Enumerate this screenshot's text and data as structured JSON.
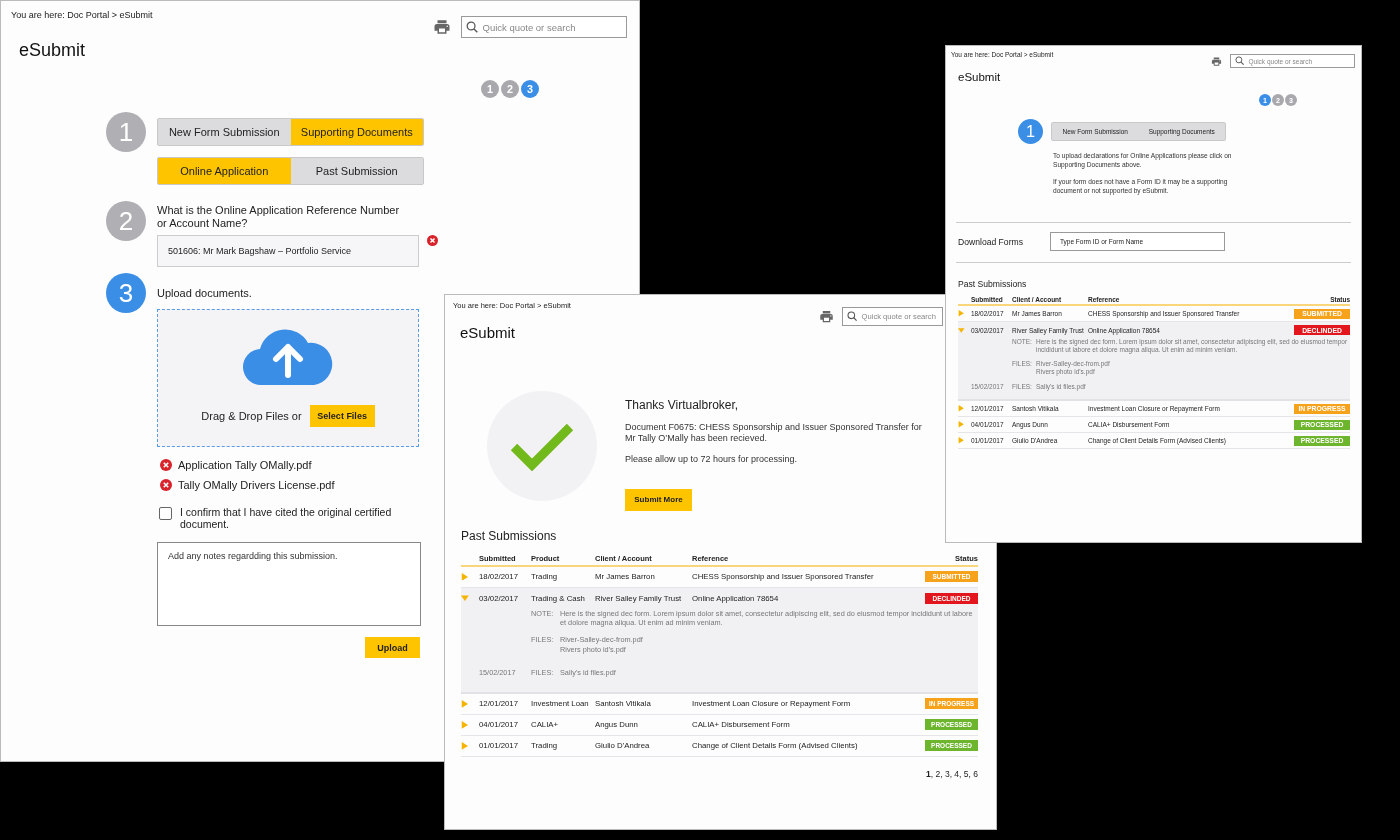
{
  "upload_screen": {
    "breadcrumb": "You are here: Doc Portal > eSubmit",
    "search": {
      "placeholder": "Quick quote or search"
    },
    "title": "eSubmit",
    "progress": [
      {
        "label": "1",
        "selected": false
      },
      {
        "label": "2",
        "selected": false
      },
      {
        "label": "3",
        "selected": true
      }
    ],
    "step_1": {
      "number": "1",
      "selected": false,
      "toggle_groups": [
        {
          "options": [
            {
              "label": "New Form Submission",
              "selected": false
            },
            {
              "label": "Supporting Documents",
              "selected": true
            }
          ]
        },
        {
          "options": [
            {
              "label": "Online Application",
              "selected": true
            },
            {
              "label": "Past Submission",
              "selected": false
            }
          ]
        }
      ]
    },
    "step_2": {
      "number": "2",
      "selected": false,
      "question": "What is the Online Application Reference Number or Account Name?",
      "answer": {
        "value": "501606: Mr Mark Bagshaw – Portfolio Service"
      }
    },
    "step_3": {
      "number": "3",
      "selected": true,
      "label": "Upload documents.",
      "dropzone": {
        "text": "Drag & Drop Files or",
        "button": "Select Files"
      },
      "files": [
        "Application Tally OMally.pdf",
        "Tally OMally Drivers License.pdf"
      ],
      "confirm": {
        "label": "I confirm that I have cited the original certified document.",
        "checked": false
      },
      "notes": {
        "placeholder": "Add any notes regardding this submission."
      },
      "submit": "Upload"
    }
  },
  "intro_screen": {
    "breadcrumb": "You are here: Doc Portal > eSubmit",
    "search": {
      "placeholder": "Quick quote or search"
    },
    "title": "eSubmit",
    "progress": [
      {
        "label": "1",
        "selected": true
      },
      {
        "label": "2",
        "selected": false
      },
      {
        "label": "3",
        "selected": false
      }
    ],
    "step_1": {
      "number": "1",
      "selected": true,
      "options": [
        {
          "label": "New Form Submission",
          "selected": false
        },
        {
          "label": "Supporting Documents",
          "selected": false
        }
      ]
    },
    "info": [
      "To upload declarations for Online Applications please click on Supporting Documents above.",
      "If your form does not have a Form ID it may be a supporting document or not supported by eSubmit."
    ],
    "download_forms": {
      "label": "Download Forms",
      "placeholder": "Type Form ID or Form Name"
    },
    "past_submissions": {
      "title": "Past Submissions",
      "columns": [
        "Submitted",
        "Client / Account",
        "Reference",
        "Status"
      ],
      "rows": [
        {
          "cells": [
            "18/02/2017",
            "Mr James Barron",
            "CHESS Sponsorship and Issuer Sponsored Transfer"
          ],
          "status": {
            "label": "SUBMITTED",
            "color": "#f7a21b"
          },
          "expanded": false
        },
        {
          "cells": [
            "03/02/2017",
            "River Salley Family Trust",
            "Online Application 78654"
          ],
          "status": {
            "label": "DECLINDED",
            "color": "#e2161c"
          },
          "expanded": true,
          "details": [
            {
              "label": "NOTE:",
              "lines": [
                "Here is the signed dec form. Lorem ipsum dolor sit amet, consectetur adipiscing elit, sed do eiusmod tempor incididunt ut labore et dolore magna aliqua. Ut enim ad minim veniam."
              ]
            },
            {
              "label": "FILES:",
              "lines": [
                "River-Salley-dec-from.pdf",
                "Rivers photo id's.pdf"
              ]
            },
            {
              "date": "15/02/2017",
              "label": "FILES:",
              "lines": [
                "Sally's id files.pdf"
              ]
            }
          ]
        },
        {
          "cells": [
            "12/01/2017",
            "Santosh Vitikala",
            "Investment Loan Closure or Repayment Form"
          ],
          "status": {
            "label": "IN PROGRESS",
            "color": "#f7a21b"
          },
          "expanded": false
        },
        {
          "cells": [
            "04/01/2017",
            "Angus Dunn",
            "CALIA+ Disbursement Form"
          ],
          "status": {
            "label": "PROCESSED",
            "color": "#6cb52d"
          },
          "expanded": false
        },
        {
          "cells": [
            "01/01/2017",
            "Giulio D'Andrea",
            "Change of Client Details Form (Advised Clients)"
          ],
          "status": {
            "label": "PROCESSED",
            "color": "#6cb52d"
          },
          "expanded": false
        }
      ]
    }
  },
  "confirmation_screen": {
    "breadcrumb": "You are here: Doc Portal > eSubmit",
    "search": {
      "placeholder": "Quick quote or search"
    },
    "title": "eSubmit",
    "heading": "Thanks Virtualbroker,",
    "message": "Document F0675: CHESS Sponsorship and Issuer Sponsored Transfer for Mr Tally O’Mally has been recieved.",
    "note": "Please allow up to 72 hours for processing.",
    "button": "Submit More",
    "past_submissions": {
      "title": "Past Submissions",
      "columns": [
        "Submitted",
        "Product",
        "Client / Account",
        "Reference",
        "Status"
      ],
      "rows": [
        {
          "cells": [
            "18/02/2017",
            "Trading",
            "Mr James Barron",
            "CHESS Sponsorship and Issuer Sponsored Transfer"
          ],
          "status": {
            "label": "SUBMITTED",
            "color": "#f7a21b"
          },
          "expanded": false
        },
        {
          "cells": [
            "03/02/2017",
            "Trading & Cash",
            "River Salley Family Trust",
            "Online Application 78654"
          ],
          "status": {
            "label": "DECLINDED",
            "color": "#e2161c"
          },
          "expanded": true,
          "details": [
            {
              "label": "NOTE:",
              "lines": [
                "Here is the signed dec form. Lorem ipsum dolor sit amet, consectetur adipiscing elit, sed do eiusmod tempor incididunt ut labore et dolore magna aliqua. Ut enim ad minim veniam."
              ]
            },
            {
              "label": "FILES:",
              "lines": [
                "River-Salley-dec-from.pdf",
                "Rivers photo id's.pdf"
              ]
            },
            {
              "date": "15/02/2017",
              "label": "FILES:",
              "lines": [
                "Sally's id files.pdf"
              ]
            }
          ]
        },
        {
          "cells": [
            "12/01/2017",
            "Investment Loan",
            "Santosh Vitikala",
            "Investment Loan Closure or Repayment Form"
          ],
          "status": {
            "label": "IN PROGRESS",
            "color": "#f7a21b"
          },
          "expanded": false
        },
        {
          "cells": [
            "04/01/2017",
            "CALIA+",
            "Angus Dunn",
            "CALIA+ Disbursement Form"
          ],
          "status": {
            "label": "PROCESSED",
            "color": "#6cb52d"
          },
          "expanded": false
        },
        {
          "cells": [
            "01/01/2017",
            "Trading",
            "Giulio D'Andrea",
            "Change of Client Details Form (Advised Clients)"
          ],
          "status": {
            "label": "PROCESSED",
            "color": "#6cb52d"
          },
          "expanded": false
        }
      ],
      "pagination": "**1**, 2, 3, 4, 5, 6"
    }
  }
}
